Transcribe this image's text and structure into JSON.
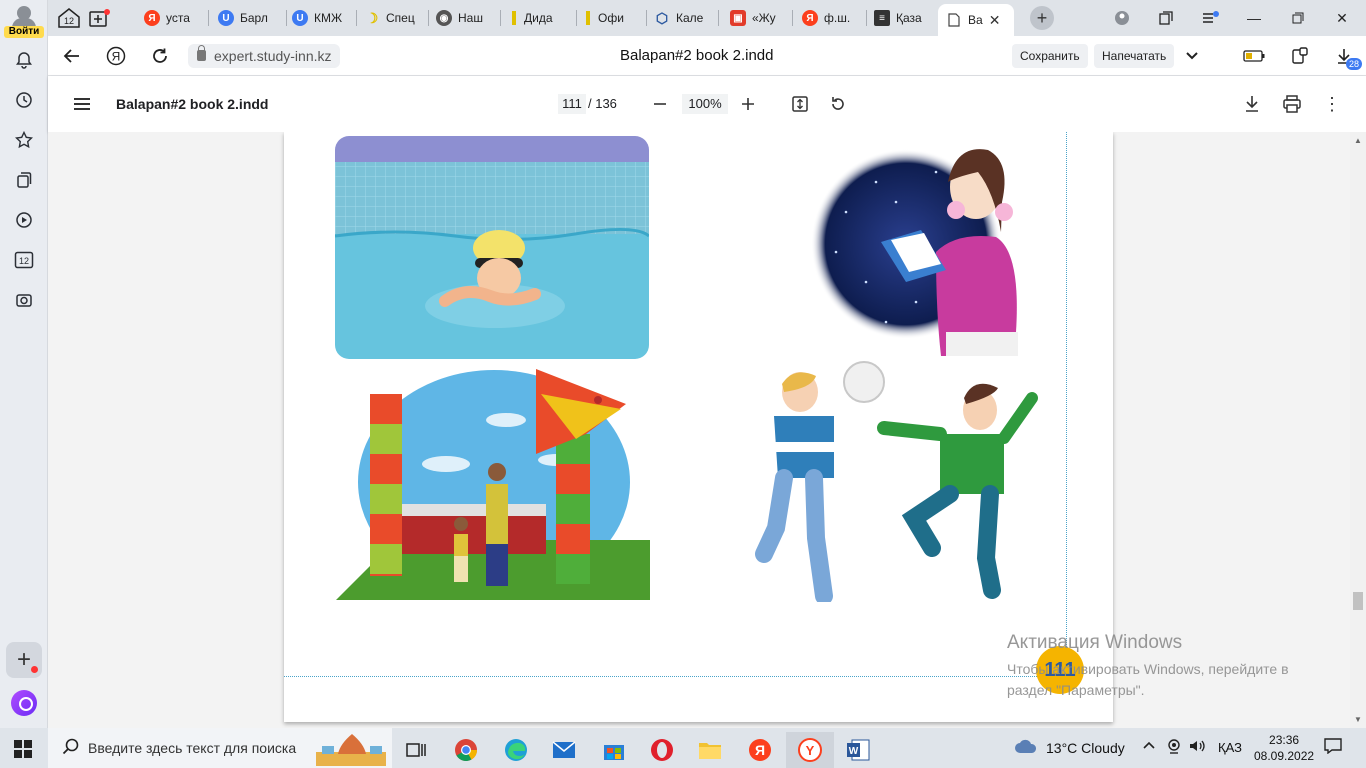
{
  "sidebar": {
    "login_label": "Войти",
    "tabs_count_label": "12"
  },
  "tabs": [
    {
      "label": "12",
      "favicon": "tab-groups",
      "color": "#555555"
    },
    {
      "label": "",
      "favicon": "new-tab",
      "color": "#555555"
    },
    {
      "label": "уста",
      "favicon": "yandex",
      "color": "#fc3f1d"
    },
    {
      "label": "Барл",
      "favicon": "u-logo",
      "color": "#3d7af2"
    },
    {
      "label": "КМЖ",
      "favicon": "u-logo",
      "color": "#3d7af2"
    },
    {
      "label": "Спец",
      "favicon": "moon",
      "color": "#e0c000"
    },
    {
      "label": "Наш",
      "favicon": "gamepad",
      "color": "#555555"
    },
    {
      "label": "Дида",
      "favicon": "bar",
      "color": "#e0c000"
    },
    {
      "label": "Офи",
      "favicon": "bar",
      "color": "#e0c000"
    },
    {
      "label": "Кале",
      "favicon": "cube",
      "color": "#2d5aa0"
    },
    {
      "label": "«Жу",
      "favicon": "red-box",
      "color": "#e23b2a"
    },
    {
      "label": "ф.ш.",
      "favicon": "yandex",
      "color": "#fc3f1d"
    },
    {
      "label": "Қаза",
      "favicon": "doc",
      "color": "#333333"
    },
    {
      "label": "Ва",
      "favicon": "page",
      "color": "#777777",
      "active": true
    }
  ],
  "addressbar": {
    "url": "expert.study-inn.kz",
    "title": "Balapan#2 book 2.indd",
    "save_label": "Сохранить",
    "print_label": "Напечатать",
    "downloads_badge": "28"
  },
  "pdf": {
    "filename": "Balapan#2 book 2.indd",
    "current_page": "111",
    "total_pages": "/ 136",
    "zoom": "100%",
    "page_badge": "111"
  },
  "watermark": {
    "title": "Активация Windows",
    "subtitle": "Чтобы активировать Windows, перейдите в раздел \"Параметры\"."
  },
  "taskbar": {
    "search_placeholder": "Введите здесь текст для поиска",
    "weather": "13°C  Cloudy",
    "lang": "ҚАЗ",
    "time": "23:36",
    "date": "08.09.2022"
  },
  "colors": {
    "accent": "#3d7af2",
    "yandex_yellow": "#ffdb4d",
    "page_badge": "#f5b400"
  }
}
